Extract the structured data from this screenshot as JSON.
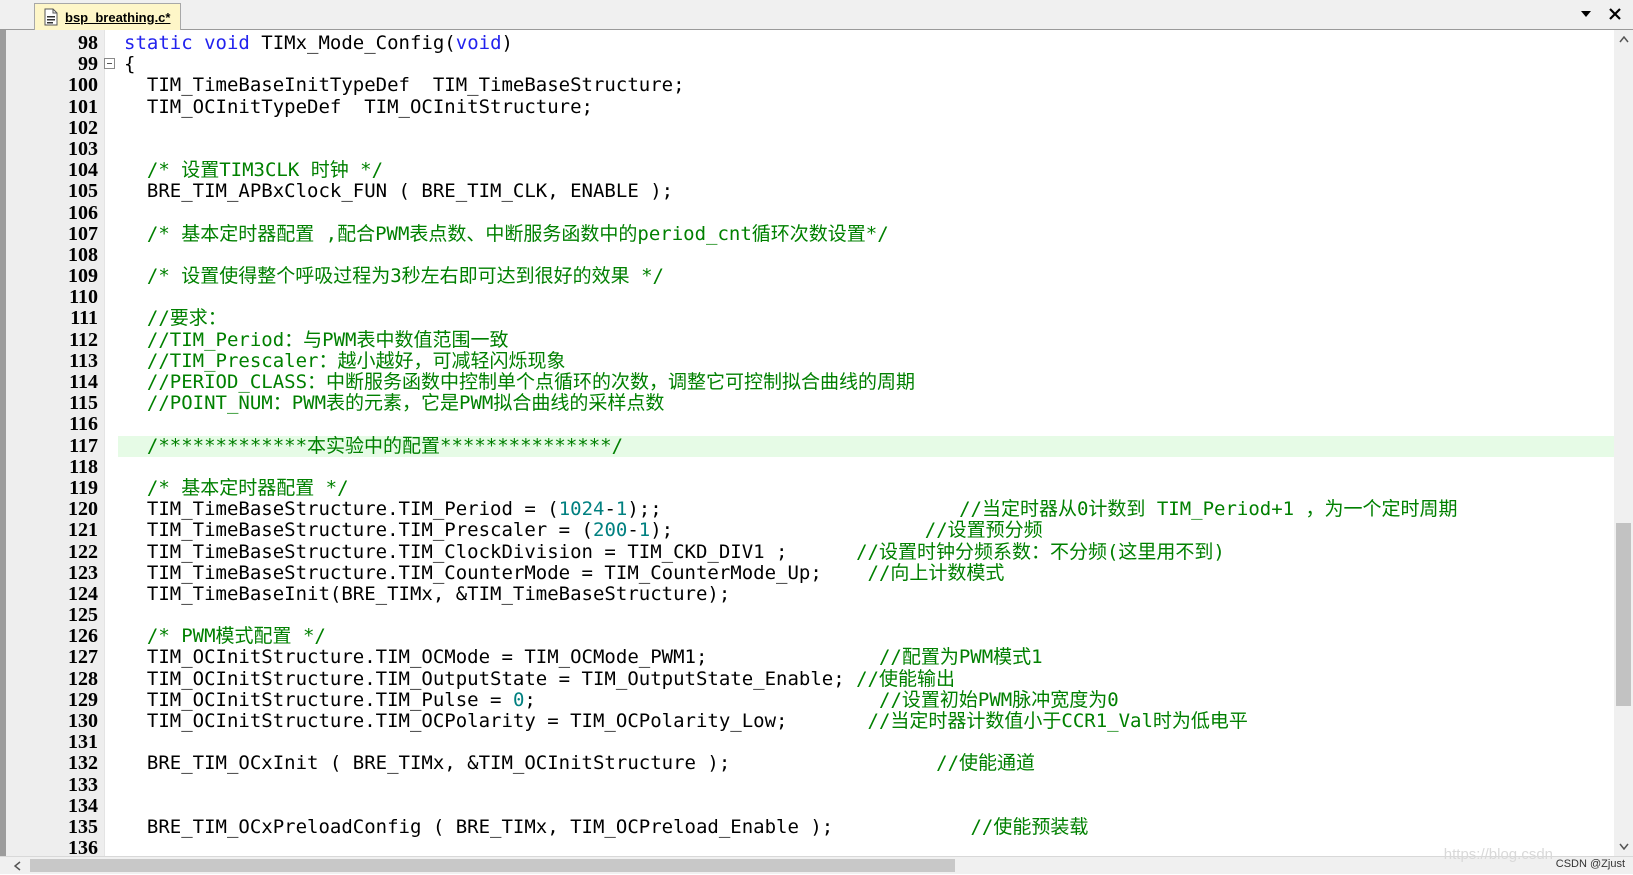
{
  "tab": {
    "label": "bsp_breathing.c*",
    "icon": "c-file-icon"
  },
  "colors": {
    "keyword": "#2222ee",
    "comment": "#008000",
    "number": "#008080",
    "highlight_line": "#e6fbe6",
    "tab_bg": "#fef6c8",
    "gutter_bg": "#eeeeee"
  },
  "watermark": {
    "text": "CSDN @Zjust",
    "faint_text": "https://blog.csdn"
  },
  "lines": [
    {
      "n": "98",
      "fold": false,
      "hl": false,
      "segs": [
        [
          "kw",
          "static void"
        ],
        [
          "tx",
          " TIMx_Mode_Config("
        ],
        [
          "kw",
          "void"
        ],
        [
          "tx",
          ")"
        ]
      ]
    },
    {
      "n": "99",
      "fold": true,
      "hl": false,
      "segs": [
        [
          "tx",
          "{"
        ]
      ]
    },
    {
      "n": "100",
      "fold": false,
      "hl": false,
      "segs": [
        [
          "tx",
          "  TIM_TimeBaseInitTypeDef  TIM_TimeBaseStructure;"
        ]
      ]
    },
    {
      "n": "101",
      "fold": false,
      "hl": false,
      "segs": [
        [
          "tx",
          "  TIM_OCInitTypeDef  TIM_OCInitStructure;"
        ]
      ]
    },
    {
      "n": "102",
      "fold": false,
      "hl": false,
      "segs": []
    },
    {
      "n": "103",
      "fold": false,
      "hl": false,
      "segs": []
    },
    {
      "n": "104",
      "fold": false,
      "hl": false,
      "segs": [
        [
          "cm",
          "  /* 设置TIM3CLK 时钟 */"
        ]
      ]
    },
    {
      "n": "105",
      "fold": false,
      "hl": false,
      "segs": [
        [
          "tx",
          "  BRE_TIM_APBxClock_FUN ( BRE_TIM_CLK, ENABLE );"
        ]
      ]
    },
    {
      "n": "106",
      "fold": false,
      "hl": false,
      "segs": []
    },
    {
      "n": "107",
      "fold": false,
      "hl": false,
      "segs": [
        [
          "cm",
          "  /* 基本定时器配置 ,配合PWM表点数、中断服务函数中的period_cnt循环次数设置*/"
        ]
      ]
    },
    {
      "n": "108",
      "fold": false,
      "hl": false,
      "segs": []
    },
    {
      "n": "109",
      "fold": false,
      "hl": false,
      "segs": [
        [
          "cm",
          "  /* 设置使得整个呼吸过程为3秒左右即可达到很好的效果 */"
        ]
      ]
    },
    {
      "n": "110",
      "fold": false,
      "hl": false,
      "segs": []
    },
    {
      "n": "111",
      "fold": false,
      "hl": false,
      "segs": [
        [
          "cm",
          "  //要求："
        ]
      ]
    },
    {
      "n": "112",
      "fold": false,
      "hl": false,
      "segs": [
        [
          "cm",
          "  //TIM_Period：与PWM表中数值范围一致"
        ]
      ]
    },
    {
      "n": "113",
      "fold": false,
      "hl": false,
      "segs": [
        [
          "cm",
          "  //TIM_Prescaler：越小越好，可减轻闪烁现象"
        ]
      ]
    },
    {
      "n": "114",
      "fold": false,
      "hl": false,
      "segs": [
        [
          "cm",
          "  //PERIOD_CLASS：中断服务函数中控制单个点循环的次数，调整它可控制拟合曲线的周期"
        ]
      ]
    },
    {
      "n": "115",
      "fold": false,
      "hl": false,
      "segs": [
        [
          "cm",
          "  //POINT_NUM：PWM表的元素，它是PWM拟合曲线的采样点数"
        ]
      ]
    },
    {
      "n": "116",
      "fold": false,
      "hl": false,
      "segs": []
    },
    {
      "n": "117",
      "fold": false,
      "hl": true,
      "segs": [
        [
          "cm",
          "  /*************本实验中的配置***************/"
        ]
      ]
    },
    {
      "n": "118",
      "fold": false,
      "hl": false,
      "segs": []
    },
    {
      "n": "119",
      "fold": false,
      "hl": false,
      "segs": [
        [
          "cm",
          "  /* 基本定时器配置 */"
        ]
      ]
    },
    {
      "n": "120",
      "fold": false,
      "hl": false,
      "segs": [
        [
          "tx",
          "  TIM_TimeBaseStructure.TIM_Period = ("
        ],
        [
          "nu",
          "1024"
        ],
        [
          "tx",
          "-"
        ],
        [
          "nu",
          "1"
        ],
        [
          "tx",
          ");;                          "
        ],
        [
          "cm",
          "//当定时器从0计数到 TIM_Period+1 ，为一个定时周期"
        ]
      ]
    },
    {
      "n": "121",
      "fold": false,
      "hl": false,
      "segs": [
        [
          "tx",
          "  TIM_TimeBaseStructure.TIM_Prescaler = ("
        ],
        [
          "nu",
          "200"
        ],
        [
          "tx",
          "-"
        ],
        [
          "nu",
          "1"
        ],
        [
          "tx",
          ");                      "
        ],
        [
          "cm",
          "//设置预分频"
        ]
      ]
    },
    {
      "n": "122",
      "fold": false,
      "hl": false,
      "segs": [
        [
          "tx",
          "  TIM_TimeBaseStructure.TIM_ClockDivision = TIM_CKD_DIV1 ;      "
        ],
        [
          "cm",
          "//设置时钟分频系数：不分频(这里用不到)"
        ]
      ]
    },
    {
      "n": "123",
      "fold": false,
      "hl": false,
      "segs": [
        [
          "tx",
          "  TIM_TimeBaseStructure.TIM_CounterMode = TIM_CounterMode_Up;    "
        ],
        [
          "cm",
          "//向上计数模式"
        ]
      ]
    },
    {
      "n": "124",
      "fold": false,
      "hl": false,
      "segs": [
        [
          "tx",
          "  TIM_TimeBaseInit(BRE_TIMx, &TIM_TimeBaseStructure);"
        ]
      ]
    },
    {
      "n": "125",
      "fold": false,
      "hl": false,
      "segs": []
    },
    {
      "n": "126",
      "fold": false,
      "hl": false,
      "segs": [
        [
          "cm",
          "  /* PWM模式配置 */"
        ]
      ]
    },
    {
      "n": "127",
      "fold": false,
      "hl": false,
      "segs": [
        [
          "tx",
          "  TIM_OCInitStructure.TIM_OCMode = TIM_OCMode_PWM1;               "
        ],
        [
          "cm",
          "//配置为PWM模式1"
        ]
      ]
    },
    {
      "n": "128",
      "fold": false,
      "hl": false,
      "segs": [
        [
          "tx",
          "  TIM_OCInitStructure.TIM_OutputState = TIM_OutputState_Enable; "
        ],
        [
          "cm",
          "//使能输出"
        ]
      ]
    },
    {
      "n": "129",
      "fold": false,
      "hl": false,
      "segs": [
        [
          "tx",
          "  TIM_OCInitStructure.TIM_Pulse = "
        ],
        [
          "nu",
          "0"
        ],
        [
          "tx",
          ";                              "
        ],
        [
          "cm",
          "//设置初始PWM脉冲宽度为0"
        ]
      ]
    },
    {
      "n": "130",
      "fold": false,
      "hl": false,
      "segs": [
        [
          "tx",
          "  TIM_OCInitStructure.TIM_OCPolarity = TIM_OCPolarity_Low;       "
        ],
        [
          "cm",
          "//当定时器计数值小于CCR1_Val时为低电平"
        ]
      ]
    },
    {
      "n": "131",
      "fold": false,
      "hl": false,
      "segs": []
    },
    {
      "n": "132",
      "fold": false,
      "hl": false,
      "segs": [
        [
          "tx",
          "  BRE_TIM_OCxInit ( BRE_TIMx, &TIM_OCInitStructure );                  "
        ],
        [
          "cm",
          "//使能通道"
        ]
      ]
    },
    {
      "n": "133",
      "fold": false,
      "hl": false,
      "segs": []
    },
    {
      "n": "134",
      "fold": false,
      "hl": false,
      "segs": []
    },
    {
      "n": "135",
      "fold": false,
      "hl": false,
      "segs": [
        [
          "tx",
          "  BRE_TIM_OCxPreloadConfig ( BRE_TIMx, TIM_OCPreload_Enable );            "
        ],
        [
          "cm",
          "//使能预装载"
        ]
      ]
    },
    {
      "n": "136",
      "fold": false,
      "hl": false,
      "segs": []
    }
  ]
}
